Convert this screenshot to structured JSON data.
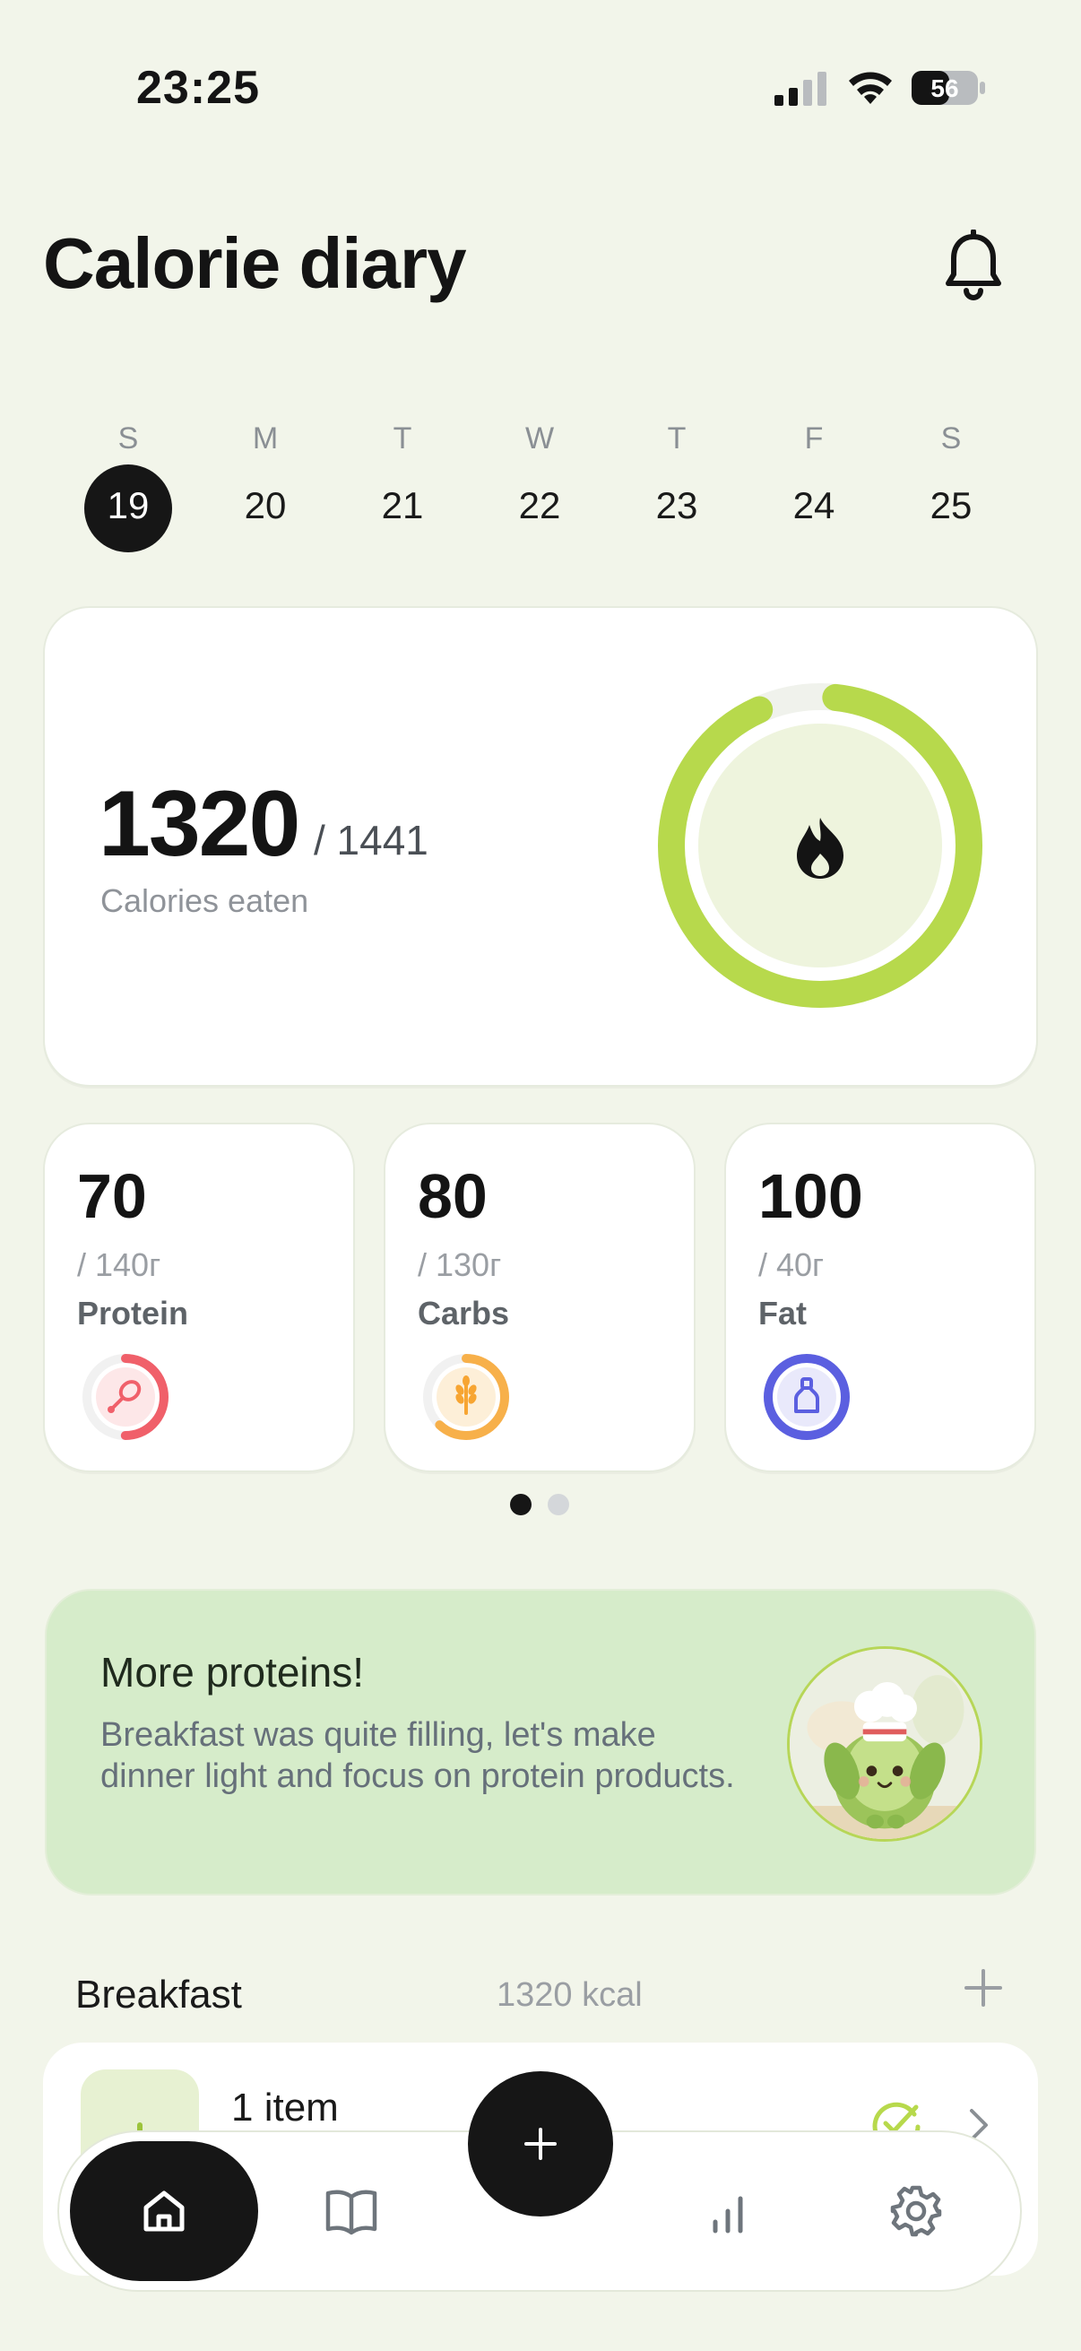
{
  "status_bar": {
    "time": "23:25",
    "battery": "56"
  },
  "header": {
    "title": "Calorie diary"
  },
  "week": {
    "days": [
      {
        "letter": "S",
        "date": "19",
        "selected": true
      },
      {
        "letter": "M",
        "date": "20"
      },
      {
        "letter": "T",
        "date": "21"
      },
      {
        "letter": "W",
        "date": "22"
      },
      {
        "letter": "T",
        "date": "23"
      },
      {
        "letter": "F",
        "date": "24"
      },
      {
        "letter": "S",
        "date": "25"
      }
    ]
  },
  "calories": {
    "eaten": "1320",
    "goal": "/ 1441",
    "label": "Calories eaten",
    "progress": 0.916
  },
  "macros": [
    {
      "value": "70",
      "goal": "/ 140г",
      "name": "Protein",
      "color": "#f0606a",
      "progress": 0.5,
      "icon": "drumstick-icon"
    },
    {
      "value": "80",
      "goal": "/ 130г",
      "name": "Carbs",
      "color": "#f7b04a",
      "progress": 0.62,
      "icon": "wheat-icon"
    },
    {
      "value": "100",
      "goal": "/ 40г",
      "name": "Fat",
      "color": "#5b5fe0",
      "progress": 1.0,
      "icon": "bottle-icon"
    }
  ],
  "pager": {
    "count": 2,
    "active": 0
  },
  "tip": {
    "title": "More proteins!",
    "body": "Breakfast was quite filling, let's make dinner light and focus on protein products."
  },
  "meal": {
    "title": "Breakfast",
    "kcal": "1320 kcal",
    "items": "1 item"
  },
  "colors": {
    "accent": "#b7d94c",
    "background": "#f2f5ea",
    "dark": "#161616"
  }
}
